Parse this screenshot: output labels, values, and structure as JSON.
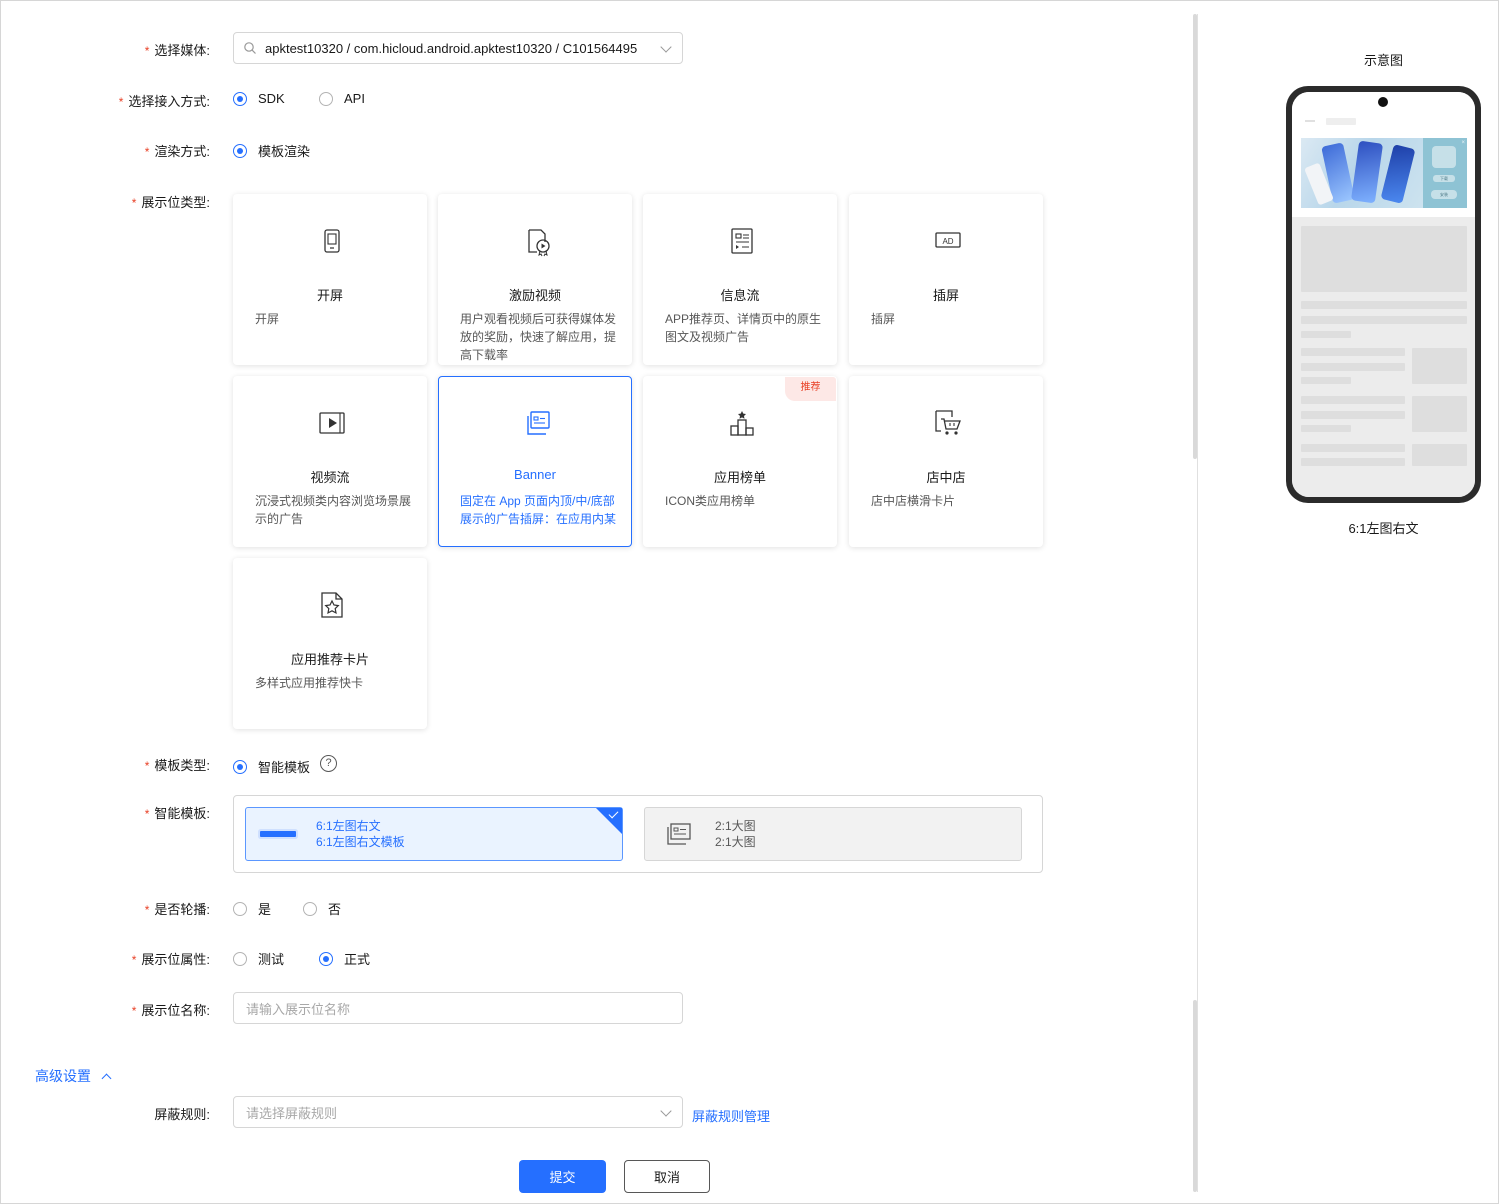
{
  "form": {
    "media": {
      "label": "选择媒体:",
      "value": "apktest10320 / com.hicloud.android.apktest10320 / C101564495"
    },
    "access": {
      "label": "选择接入方式:",
      "options": [
        "SDK",
        "API"
      ],
      "selected": "SDK"
    },
    "render": {
      "label": "渲染方式:",
      "options": [
        "模板渲染"
      ],
      "selected": "模板渲染"
    },
    "slot_type": {
      "label": "展示位类型:",
      "cards": [
        {
          "title": "开屏",
          "desc": "开屏",
          "icon": "phone-icon"
        },
        {
          "title": "激励视频",
          "desc": "用户观看视频后可获得媒体发放的奖励，快速了解应用，提高下载率",
          "icon": "reward-video-icon"
        },
        {
          "title": "信息流",
          "desc": "APP推荐页、详情页中的原生图文及视频广告",
          "icon": "feed-icon"
        },
        {
          "title": "插屏",
          "desc": "插屏",
          "icon": "ad-icon"
        },
        {
          "title": "视频流",
          "desc": "沉浸式视频类内容浏览场景展示的广告",
          "icon": "video-icon"
        },
        {
          "title": "Banner",
          "desc": "固定在 App 页面内顶/中/底部展示的广告插屏：在应用内某",
          "icon": "banner-icon"
        },
        {
          "title": "应用榜单",
          "desc": "ICON类应用榜单",
          "icon": "ranking-icon",
          "tag": "推荐"
        },
        {
          "title": "店中店",
          "desc": "店中店横滑卡片",
          "icon": "cart-icon"
        },
        {
          "title": "应用推荐卡片",
          "desc": "多样式应用推荐快卡",
          "icon": "star-card-icon"
        }
      ],
      "selected": "Banner"
    },
    "template_type": {
      "label": "模板类型:",
      "options": [
        "智能模板"
      ],
      "selected": "智能模板"
    },
    "smart_template": {
      "label": "智能模板:",
      "items": [
        {
          "line1": "6:1左图右文",
          "line2": "6:1左图右文模板",
          "selected": true
        },
        {
          "line1": "2:1大图",
          "line2": "2:1大图",
          "selected": false
        }
      ]
    },
    "carousel": {
      "label": "是否轮播:",
      "options": [
        "是",
        "否"
      ],
      "selected": null
    },
    "slot_attr": {
      "label": "展示位属性:",
      "options": [
        "测试",
        "正式"
      ],
      "selected": "正式"
    },
    "slot_name": {
      "label": "展示位名称:",
      "placeholder": "请输入展示位名称"
    },
    "advanced": {
      "label": "高级设置",
      "expanded": true
    },
    "block_rule": {
      "label": "屏蔽规则:",
      "placeholder": "请选择屏蔽规则",
      "manage_link": "屏蔽规则管理"
    },
    "actions": {
      "submit": "提交",
      "cancel": "取消"
    }
  },
  "preview": {
    "title": "示意图",
    "caption": "6:1左图右文",
    "banner_btn1": "下载",
    "banner_btn2": "安装"
  },
  "colors": {
    "primary": "#256fff",
    "required": "#e84026",
    "text": "#191919"
  }
}
